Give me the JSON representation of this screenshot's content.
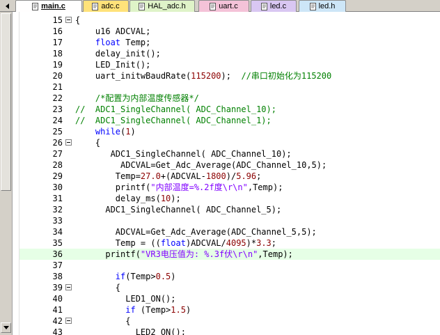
{
  "tabs": [
    {
      "label": "main.c",
      "active": true,
      "color": "#fffefe",
      "icon": "c-file-icon"
    },
    {
      "label": "adc.c",
      "active": false,
      "color": "#ffe27a",
      "icon": "c-file-icon"
    },
    {
      "label": "HAL_adc.h",
      "active": false,
      "color": "#dff3c8",
      "icon": "h-file-icon"
    },
    {
      "label": "uart.c",
      "active": false,
      "color": "#f4c2d8",
      "icon": "c-file-icon"
    },
    {
      "label": "led.c",
      "active": false,
      "color": "#d9c7f2",
      "icon": "c-file-icon"
    },
    {
      "label": "led.h",
      "active": false,
      "color": "#cde6f7",
      "icon": "h-file-icon"
    }
  ],
  "colors": {
    "keyword": "#0000ff",
    "number": "#8b0000",
    "string": "#8000ff",
    "comment": "#008000",
    "current_line": "#e6ffe6"
  },
  "lines": [
    {
      "n": "15",
      "fold": true,
      "segs": [
        [
          "t",
          "{"
        ]
      ]
    },
    {
      "n": "16",
      "fold": false,
      "segs": [
        [
          "t",
          "    u16 ADCVAL;"
        ]
      ]
    },
    {
      "n": "17",
      "fold": false,
      "segs": [
        [
          "t",
          "    "
        ],
        [
          "k",
          "float"
        ],
        [
          "t",
          " Temp;"
        ]
      ]
    },
    {
      "n": "18",
      "fold": false,
      "segs": [
        [
          "t",
          "    delay_init();"
        ]
      ]
    },
    {
      "n": "19",
      "fold": false,
      "segs": [
        [
          "t",
          "    LED_Init();"
        ]
      ]
    },
    {
      "n": "20",
      "fold": false,
      "segs": [
        [
          "t",
          "    uart_initwBaudRate("
        ],
        [
          "n",
          "115200"
        ],
        [
          "t",
          ");  "
        ],
        [
          "c",
          "//串口初始化为115200"
        ]
      ]
    },
    {
      "n": "21",
      "fold": false,
      "segs": [
        [
          "t",
          ""
        ]
      ]
    },
    {
      "n": "22",
      "fold": false,
      "segs": [
        [
          "t",
          "    "
        ],
        [
          "c",
          "/*配置为内部温度传感器*/"
        ]
      ]
    },
    {
      "n": "23",
      "fold": false,
      "segs": [
        [
          "c",
          "//  ADC1_SingleChannel( ADC_Channel_10);"
        ]
      ]
    },
    {
      "n": "24",
      "fold": false,
      "segs": [
        [
          "c",
          "//  ADC1_SingleChannel( ADC_Channel_1);"
        ]
      ]
    },
    {
      "n": "25",
      "fold": false,
      "segs": [
        [
          "t",
          "    "
        ],
        [
          "k",
          "while"
        ],
        [
          "t",
          "("
        ],
        [
          "n",
          "1"
        ],
        [
          "t",
          ")"
        ]
      ]
    },
    {
      "n": "26",
      "fold": true,
      "segs": [
        [
          "t",
          "    {"
        ]
      ]
    },
    {
      "n": "27",
      "fold": false,
      "segs": [
        [
          "t",
          "       ADC1_SingleChannel( ADC_Channel_10);"
        ]
      ]
    },
    {
      "n": "28",
      "fold": false,
      "segs": [
        [
          "t",
          "         ADCVAL=Get_Adc_Average(ADC_Channel_10,5);"
        ]
      ]
    },
    {
      "n": "29",
      "fold": false,
      "segs": [
        [
          "t",
          "        Temp="
        ],
        [
          "n",
          "27.0"
        ],
        [
          "t",
          "+(ADCVAL-"
        ],
        [
          "n",
          "1800"
        ],
        [
          "t",
          ")/"
        ],
        [
          "n",
          "5.96"
        ],
        [
          "t",
          ";"
        ]
      ]
    },
    {
      "n": "30",
      "fold": false,
      "segs": [
        [
          "t",
          "        printf("
        ],
        [
          "s",
          "\"内部温度=%.2f度\\r\\n\""
        ],
        [
          "t",
          ",Temp);"
        ]
      ]
    },
    {
      "n": "31",
      "fold": false,
      "segs": [
        [
          "t",
          "        delay_ms("
        ],
        [
          "n",
          "10"
        ],
        [
          "t",
          ");"
        ]
      ]
    },
    {
      "n": "32",
      "fold": false,
      "segs": [
        [
          "t",
          "      ADC1_SingleChannel( ADC_Channel_5);"
        ]
      ]
    },
    {
      "n": "33",
      "fold": false,
      "segs": [
        [
          "t",
          ""
        ]
      ]
    },
    {
      "n": "34",
      "fold": false,
      "segs": [
        [
          "t",
          "        ADCVAL=Get_Adc_Average(ADC_Channel_5,5);"
        ]
      ]
    },
    {
      "n": "35",
      "fold": false,
      "segs": [
        [
          "t",
          "        Temp = (("
        ],
        [
          "k",
          "float"
        ],
        [
          "t",
          ")ADCVAL/"
        ],
        [
          "n",
          "4095"
        ],
        [
          "t",
          ")*"
        ],
        [
          "n",
          "3.3"
        ],
        [
          "t",
          ";"
        ]
      ]
    },
    {
      "n": "36",
      "fold": false,
      "hl": true,
      "segs": [
        [
          "t",
          "      printf("
        ],
        [
          "s",
          "\"VR3电压值为: %.3f伏\\r\\n\""
        ],
        [
          "t",
          ",Temp);"
        ]
      ]
    },
    {
      "n": "37",
      "fold": false,
      "segs": [
        [
          "t",
          ""
        ]
      ]
    },
    {
      "n": "38",
      "fold": false,
      "segs": [
        [
          "t",
          "        "
        ],
        [
          "k",
          "if"
        ],
        [
          "t",
          "(Temp>"
        ],
        [
          "n",
          "0.5"
        ],
        [
          "t",
          ")"
        ]
      ]
    },
    {
      "n": "39",
      "fold": true,
      "segs": [
        [
          "t",
          "        {"
        ]
      ]
    },
    {
      "n": "40",
      "fold": false,
      "segs": [
        [
          "t",
          "          LED1_ON();"
        ]
      ]
    },
    {
      "n": "41",
      "fold": false,
      "segs": [
        [
          "t",
          "          "
        ],
        [
          "k",
          "if"
        ],
        [
          "t",
          " (Temp>"
        ],
        [
          "n",
          "1.5"
        ],
        [
          "t",
          ")"
        ]
      ]
    },
    {
      "n": "42",
      "fold": true,
      "segs": [
        [
          "t",
          "          {"
        ]
      ]
    },
    {
      "n": "43",
      "fold": false,
      "segs": [
        [
          "t",
          "            LED2_ON();"
        ]
      ]
    }
  ]
}
